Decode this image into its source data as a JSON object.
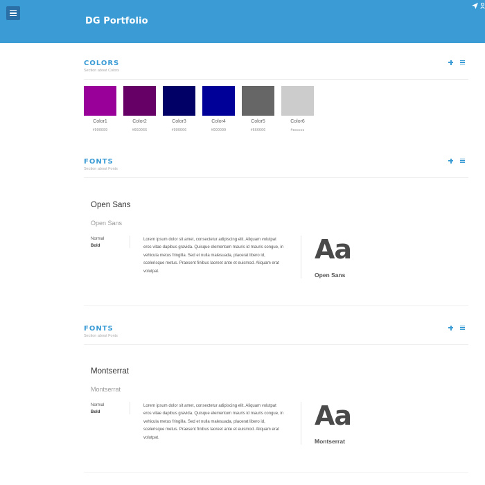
{
  "header": {
    "brand": "DG Portfolio",
    "menu_icon": "hamburger-icon",
    "right_icons": [
      "send-icon",
      "user-icon"
    ],
    "bg_color": "#3a9bd5"
  },
  "colors_section": {
    "title": "COLORS",
    "subtitle": "Section about Colors",
    "swatches": [
      {
        "name": "Color1",
        "hex": "#990099",
        "fill": "#990099"
      },
      {
        "name": "Color2",
        "hex": "#660066",
        "fill": "#660066"
      },
      {
        "name": "Color3",
        "hex": "#000066",
        "fill": "#000066"
      },
      {
        "name": "Color4",
        "hex": "#000099",
        "fill": "#000099"
      },
      {
        "name": "Color5",
        "hex": "#666666",
        "fill": "#666666"
      },
      {
        "name": "Color6",
        "hex": "#cccccc",
        "fill": "#cccccc"
      }
    ]
  },
  "fonts_sections": [
    {
      "title": "FONTS",
      "subtitle": "Section about Fonts",
      "font_name": "Open Sans",
      "font_sub": "Open Sans",
      "weight_normal": "Normal",
      "weight_bold": "Bold",
      "lorem": "Lorem ipsum dolor sit amet, consectetur adipiscing elit. Aliquam volutpat eros vitae dapibus gravida. Quisque elementum mauris id mauris congue, in vehicula metus fringilla. Sed et nulla malesuada, placerat libero id, scelerisque metus. Praesent finibus laoreet ante et euismod. Aliquam erat volutpat.",
      "sample": "Aa",
      "sample_name": "Open Sans"
    },
    {
      "title": "FONTS",
      "subtitle": "Section about Fonts",
      "font_name": "Montserrat",
      "font_sub": "Montserrat",
      "weight_normal": "Normal",
      "weight_bold": "Bold",
      "lorem": "Lorem ipsum dolor sit amet, consectetur adipiscing elit. Aliquam volutpat eros vitae dapibus gravida. Quisque elementum mauris id mauris congue, in vehicula metus fringilla. Sed et nulla malesuada, placerat libero id, scelerisque metus. Praesent finibus laoreet ante et euismod. Aliquam erat volutpat.",
      "sample": "Aa",
      "sample_name": "Montserrat"
    }
  ],
  "accent_color": "#3a9bd5"
}
